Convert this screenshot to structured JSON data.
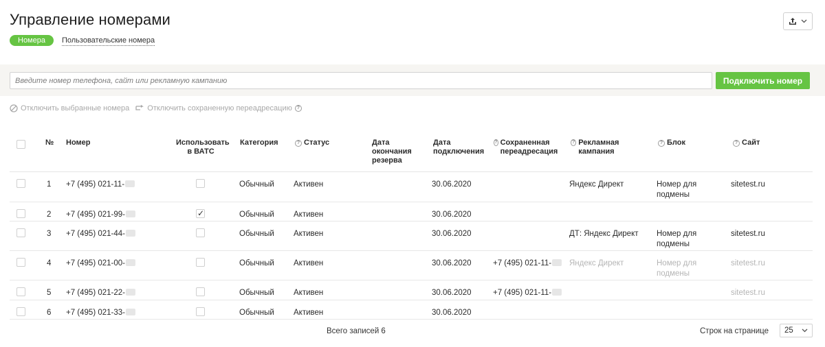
{
  "page": {
    "title": "Управление номерами",
    "tabs": [
      {
        "label": "Номера",
        "active": true
      },
      {
        "label": "Пользовательские номера",
        "active": false
      }
    ]
  },
  "search": {
    "placeholder": "Введите номер телефона, сайт или рекламную кампанию",
    "value": "",
    "connect_label": "Подключить номер"
  },
  "actions": {
    "disconnect_selected": "Отключить выбранные номера",
    "disconnect_forwarding": "Отключить сохраненную переадресацию"
  },
  "table": {
    "headers": {
      "num": "№",
      "number": "Номер",
      "use_vats": "Использовать в ВАТС",
      "category": "Категория",
      "status": "Статус",
      "reserve_end": "Дата окончания резерва",
      "connect_date": "Дата подключения",
      "saved_forward": "Сохраненная переадресация",
      "campaign": "Рекламная кампания",
      "block": "Блок",
      "site": "Сайт"
    },
    "rows": [
      {
        "num": "1",
        "number": "+7 (495) 021-11-",
        "vats": false,
        "category": "Обычный",
        "status": "Активен",
        "reserve_end": "",
        "connect_date": "30.06.2020",
        "forward": "",
        "campaign": "Яндекс Директ",
        "block": "Номер для подмены",
        "site": "sitetest.ru",
        "muted": false
      },
      {
        "num": "2",
        "number": "+7 (495) 021-99-",
        "vats": true,
        "category": "Обычный",
        "status": "Активен",
        "reserve_end": "",
        "connect_date": "30.06.2020",
        "forward": "",
        "campaign": "",
        "block": "",
        "site": "",
        "muted": false
      },
      {
        "num": "3",
        "number": "+7 (495) 021-44-",
        "vats": false,
        "category": "Обычный",
        "status": "Активен",
        "reserve_end": "",
        "connect_date": "30.06.2020",
        "forward": "",
        "campaign": "ДТ: Яндекс Директ",
        "block": "Номер для подмены",
        "site": "sitetest.ru",
        "muted": false
      },
      {
        "num": "4",
        "number": "+7 (495) 021-00-",
        "vats": false,
        "category": "Обычный",
        "status": "Активен",
        "reserve_end": "",
        "connect_date": "30.06.2020",
        "forward": "+7 (495) 021-11-",
        "campaign": "Яндекс Директ",
        "block": "Номер для подмены",
        "site": "sitetest.ru",
        "muted": true
      },
      {
        "num": "5",
        "number": "+7 (495) 021-22-",
        "vats": false,
        "category": "Обычный",
        "status": "Активен",
        "reserve_end": "",
        "connect_date": "30.06.2020",
        "forward": "+7 (495) 021-11-",
        "campaign": "",
        "block": "",
        "site": "sitetest.ru",
        "muted": true
      },
      {
        "num": "6",
        "number": "+7 (495) 021-33-",
        "vats": false,
        "category": "Обычный",
        "status": "Активен",
        "reserve_end": "",
        "connect_date": "30.06.2020",
        "forward": "",
        "campaign": "",
        "block": "",
        "site": "",
        "muted": false
      }
    ]
  },
  "footer": {
    "total": "Всего записей 6",
    "rows_label": "Строк на странице",
    "page_size": "25"
  },
  "colors": {
    "accent": "#66c443",
    "muted_text": "#b5b5b5"
  },
  "icons": [
    "upload-icon",
    "chevron-down-icon",
    "ban-icon",
    "forward-icon",
    "help-icon",
    "checkbox-icon"
  ]
}
